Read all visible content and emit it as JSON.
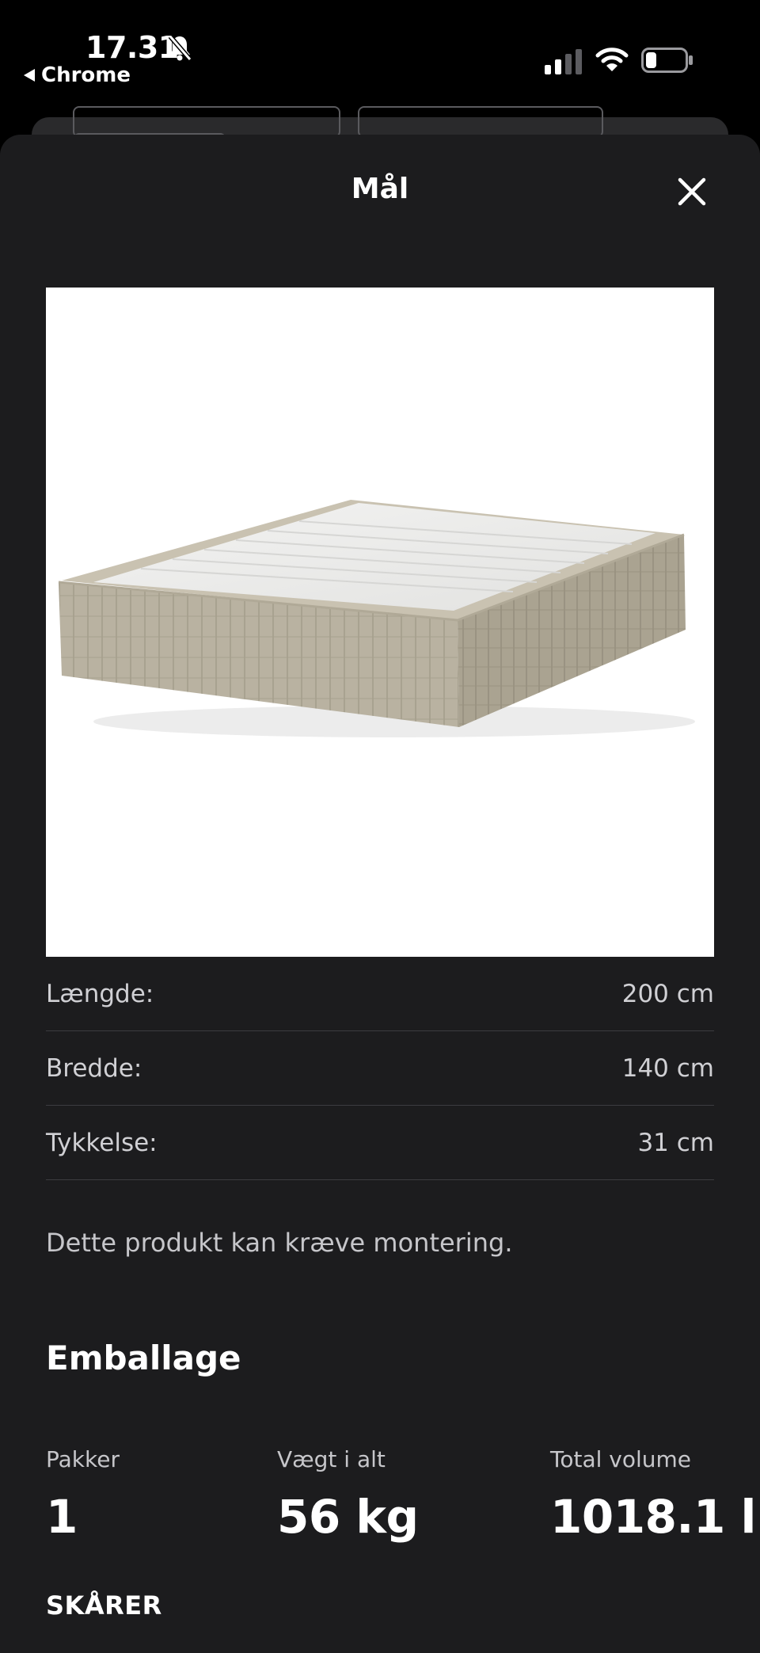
{
  "status_bar": {
    "time": "17.31",
    "back_app": "Chrome",
    "icons": [
      "bell-muted-icon",
      "cellular-signal-icon",
      "wifi-icon",
      "battery-icon"
    ]
  },
  "sheet": {
    "title": "Mål",
    "close_icon": "close-icon"
  },
  "product": {
    "image_alt": "box spring base with quilted beige cover and white top"
  },
  "dimensions": [
    {
      "label": "Længde:",
      "value": "200 cm"
    },
    {
      "label": "Bredde:",
      "value": "140 cm"
    },
    {
      "label": "Tykkelse:",
      "value": "31 cm"
    }
  ],
  "assembly_note": "Dette produkt kan kræve montering.",
  "packaging": {
    "title": "Emballage",
    "items": [
      {
        "label": "Pakker",
        "value": "1"
      },
      {
        "label": "Vægt i alt",
        "value": "56 kg"
      },
      {
        "label": "Total volume",
        "value": "1018.1 l"
      }
    ]
  },
  "next_section": "SKÅRER",
  "colors": {
    "sheet_bg": "#1c1c1e",
    "divider": "#3c3c40",
    "muted_text": "#c6c6ca"
  }
}
